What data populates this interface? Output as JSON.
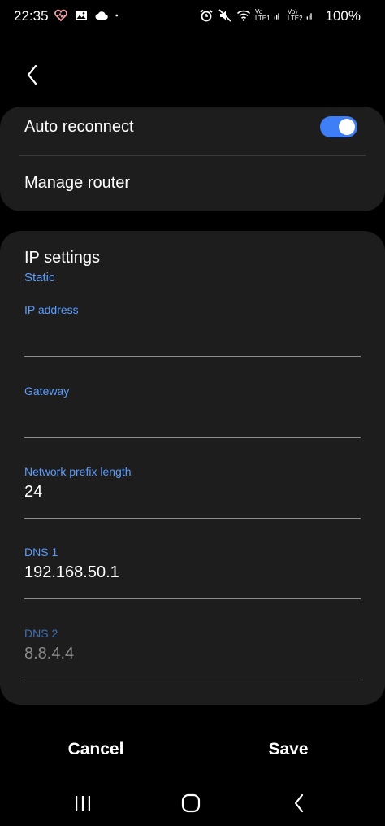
{
  "status_bar": {
    "time": "22:35",
    "battery": "100%",
    "sim1_label": "Vo LTE1",
    "sim2_label": "Vo) LTE2",
    "left_icons": [
      "health-heart-icon",
      "gallery-icon",
      "cloud-icon",
      "dot-icon"
    ],
    "right_icons": [
      "alarm-icon",
      "mute-icon",
      "wifi-icon",
      "signal-icon"
    ]
  },
  "header": {
    "back_icon": "chevron-left-icon"
  },
  "options": {
    "auto_reconnect_label": "Auto reconnect",
    "auto_reconnect_on": true,
    "manage_router_label": "Manage router"
  },
  "ip_settings": {
    "title": "IP settings",
    "mode": "Static",
    "fields": [
      {
        "label": "IP address",
        "value": ""
      },
      {
        "label": "Gateway",
        "value": ""
      },
      {
        "label": "Network prefix length",
        "value": "24"
      },
      {
        "label": "DNS 1",
        "value": "192.168.50.1"
      },
      {
        "label": "DNS 2",
        "value": "8.8.4.4"
      }
    ]
  },
  "actions": {
    "cancel_label": "Cancel",
    "save_label": "Save"
  },
  "nav": {
    "items": [
      "recents-icon",
      "home-icon",
      "back-icon"
    ]
  },
  "colors": {
    "accent": "#3e7ef6",
    "label_blue": "#5a9cff",
    "card_bg": "#1d1d1d"
  }
}
